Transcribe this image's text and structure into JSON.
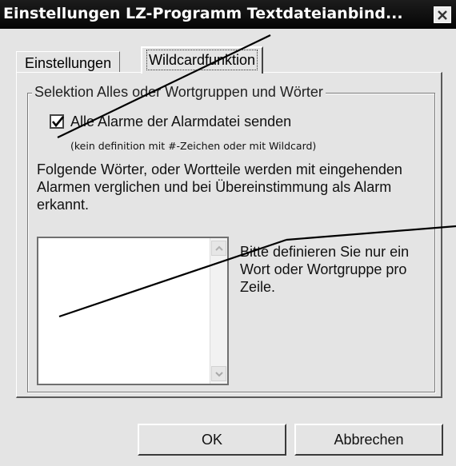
{
  "window": {
    "title": "Einstellungen LZ-Programm Textdateianbind..."
  },
  "tabs": [
    {
      "label": "Einstellungen",
      "active": false
    },
    {
      "label": "Wildcardfunktion",
      "active": true
    }
  ],
  "group": {
    "legend": "Selektion Alles oder Wortgruppen und Wörter",
    "checkbox_label": "Alle Alarme der Alarmdatei senden",
    "checkbox_checked": true,
    "checkbox_note": "(kein definition mit #-Zeichen oder mit Wildcard)",
    "description": "Folgende Wörter, oder Wortteile werden mit eingehenden Alarmen verglichen und bei Übereinstimmung als Alarm erkannt.",
    "hint": "Bitte definieren Sie nur ein Wort oder Wortgruppe pro Zeile.",
    "listbox_value": ""
  },
  "buttons": {
    "ok": "OK",
    "cancel": "Abbrechen"
  },
  "icons": {
    "close": "close-icon",
    "check": "checkmark-icon",
    "scroll_up": "chevron-up-icon",
    "scroll_down": "chevron-down-icon"
  },
  "colors": {
    "titlebar": "#0a0a0a",
    "dialog_bg": "#e4e4e4"
  }
}
